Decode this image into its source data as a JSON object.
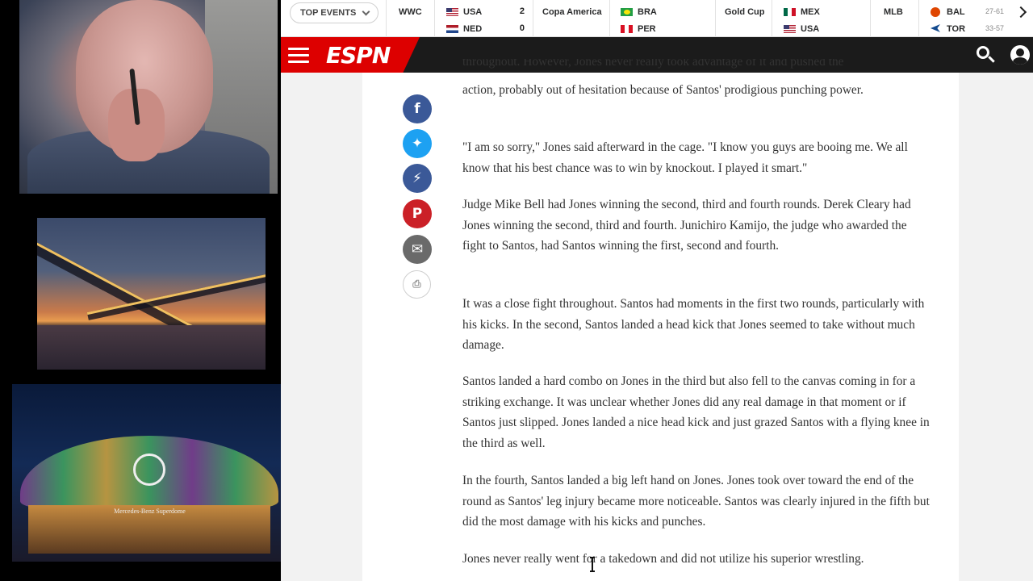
{
  "scoreboard": {
    "top_events_label": "TOP EVENTS",
    "games": [
      {
        "league": "WWC",
        "team1": "USA",
        "score1": "2",
        "team2": "NED",
        "score2": "0"
      },
      {
        "league": "Copa America",
        "team1": "BRA",
        "team2": "PER"
      },
      {
        "league": "Gold Cup",
        "team1": "MEX",
        "team2": "USA"
      },
      {
        "league": "MLB",
        "team1": "BAL",
        "record1": "27-61",
        "team2": "TOR",
        "record2": "33-57"
      }
    ]
  },
  "header": {
    "logo": "ESPN"
  },
  "article": {
    "partial_top_line": "throughout. However, Jones never really took advantage of it and pushed the",
    "paragraphs": [
      "action, probably out of hesitation because of Santos' prodigious punching power.",
      "\"I am so sorry,\" Jones said afterward in the cage. \"I know you guys are booing me. We all know that his best chance was to win by knockout. I played it smart.\"",
      "Judge Mike Bell had Jones winning the second, third and fourth rounds. Derek Cleary had Jones winning the second, third and fourth. Junichiro Kamijo, the judge who awarded the fight to Santos, had Santos winning the first, second and fourth.",
      "It was a close fight throughout. Santos had moments in the first two rounds, particularly with his kicks. In the second, Santos landed a head kick that Jones seemed to take without much damage.",
      "Santos landed a hard combo on Jones in the third but also fell to the canvas coming in for a striking exchange. It was unclear whether Jones did any real damage in that moment or if Santos just slipped. Jones landed a nice head kick and just grazed Santos with a flying knee in the third as well.",
      "In the fourth, Santos landed a big left hand on Jones. Jones took over toward the end of the round as Santos' leg injury became more noticeable. Santos was clearly injured in the fifth but did the most damage with his kicks and punches.",
      "Jones never really went for a takedown and did not utilize his superior wrestling."
    ]
  },
  "side_images": {
    "stadium_sign": "Mercedes-Benz Superdome"
  },
  "colors": {
    "espn_red": "#dd0000",
    "header_dark": "#1b1b1b",
    "facebook": "#3b5998",
    "twitter": "#1da1f2",
    "pinterest": "#cb2027"
  }
}
